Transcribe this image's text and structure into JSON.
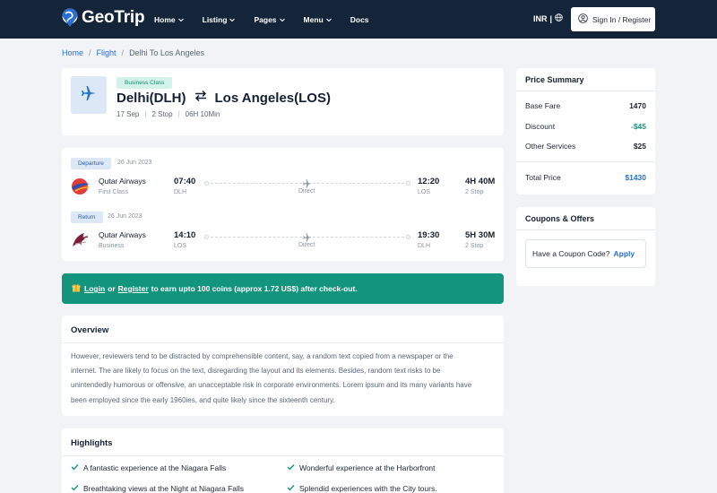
{
  "brand": {
    "name": "GeoTrip"
  },
  "nav": {
    "items": [
      "Home",
      "Listing",
      "Pages",
      "Menu",
      "Docs"
    ]
  },
  "header": {
    "currency": "INR",
    "signin_label": "Sign In / Register"
  },
  "breadcrumb": {
    "home": "Home",
    "flight": "Flight",
    "current": "Delhi To Los Angeles"
  },
  "flight": {
    "class": "Business Class",
    "from": "Delhi(DLH)",
    "to": "Los Angeles(LOS)",
    "date": "17 Sep",
    "stops": "2 Stop",
    "duration": "06H 10Min"
  },
  "legs": [
    {
      "tag": "Departure",
      "date": "26 Jun 2023",
      "airline": "Qutar Airways",
      "cabin": "First Class",
      "dep_time": "07:40",
      "dep_code": "DLH",
      "type": "Direct",
      "arr_time": "12:20",
      "arr_code": "LOS",
      "duration": "4H 40M",
      "stops": "2 Stop"
    },
    {
      "tag": "Return",
      "date": "26 Jun 2023",
      "airline": "Qutar Airways",
      "cabin": "Business",
      "dep_time": "14:10",
      "dep_code": "LOS",
      "type": "Direct",
      "arr_time": "19:30",
      "arr_code": "DLH",
      "duration": "5H 30M",
      "stops": "2 Stop"
    }
  ],
  "promo": {
    "login": "Login",
    "or": "or",
    "register": "Register",
    "text": "to earn upto 100 coins (approx 1.72 US$) after check-out."
  },
  "overview": {
    "title": "Overview",
    "lines": [
      "However, reviewers tend to be distracted by comprehensible content, say, a random text copied from a newspaper or the",
      "internet. The are likely to focus on the text, disregarding the layout and its elements. Besides, random text risks to be",
      "unintendedly humorous or offensive, an unacceptable risk in corporate environments. Lorem ipsum and its many variants have",
      "been employed since the early 1960ies, and quite likely since the sixteenth century."
    ]
  },
  "highlights": {
    "title": "Highlights",
    "items": [
      "A fantastic experience at the Niagara Falls",
      "Wonderful experience at the Harborfront",
      "Breathtaking views at the Night at Niagara Falls",
      "Splendid experiences with the City tours."
    ]
  },
  "price_summary": {
    "title": "Price Summary",
    "rows": [
      {
        "label": "Base Fare",
        "value": "1470"
      },
      {
        "label": "Discount",
        "value": "-$45"
      },
      {
        "label": "Other Services",
        "value": "$25"
      }
    ],
    "total_label": "Total Price",
    "total_value": "$1430"
  },
  "coupons": {
    "title": "Coupons & Offers",
    "prompt": "Have a Coupon Code?",
    "apply": "Apply"
  },
  "colors": {
    "navbar": "#14253a",
    "accent_green": "#13957d",
    "link_blue": "#2a6fd6",
    "background": "#f1f3f6"
  }
}
